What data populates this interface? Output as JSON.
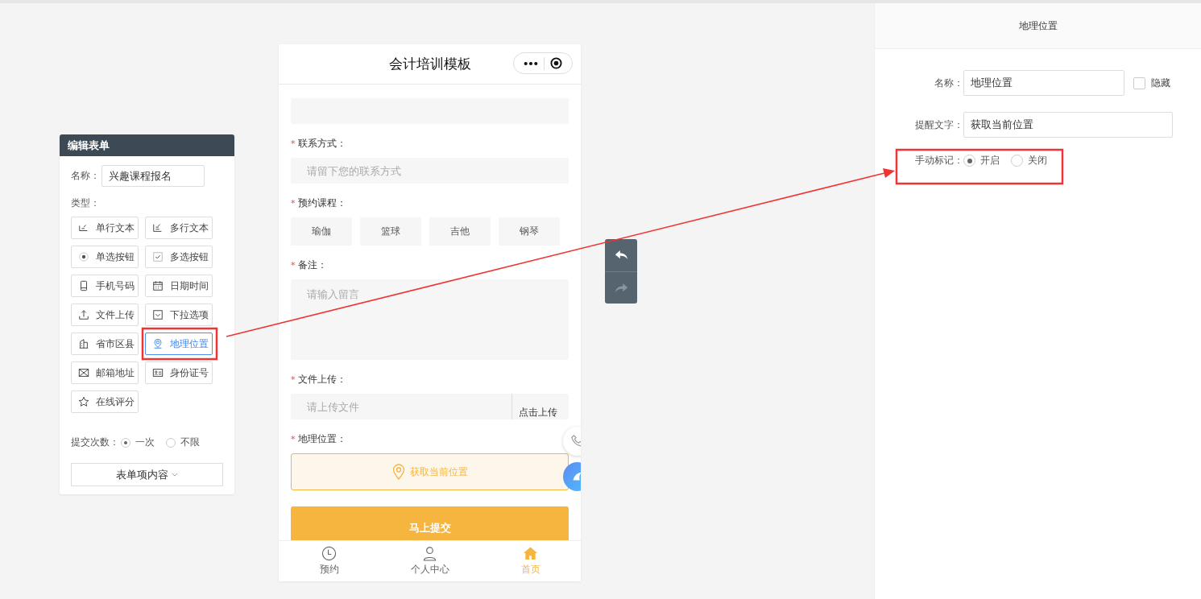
{
  "editor": {
    "title": "编辑表单",
    "name_label": "名称：",
    "name_value": "兴趣课程报名",
    "type_label": "类型：",
    "types": [
      {
        "label": "单行文本",
        "selected": false
      },
      {
        "label": "多行文本",
        "selected": false
      },
      {
        "label": "单选按钮",
        "selected": false
      },
      {
        "label": "多选按钮",
        "selected": false
      },
      {
        "label": "手机号码",
        "selected": false
      },
      {
        "label": "日期时间",
        "selected": false
      },
      {
        "label": "文件上传",
        "selected": false
      },
      {
        "label": "下拉选项",
        "selected": false
      },
      {
        "label": "省市区县",
        "selected": false
      },
      {
        "label": "地理位置",
        "selected": true
      },
      {
        "label": "邮箱地址",
        "selected": false
      },
      {
        "label": "身份证号",
        "selected": false
      },
      {
        "label": "在线评分",
        "selected": false
      }
    ],
    "submit_label": "提交次数：",
    "submit_options": [
      {
        "label": "一次",
        "selected": true
      },
      {
        "label": "不限",
        "selected": false
      }
    ],
    "content_button": "表单项内容"
  },
  "phone": {
    "title": "会计培训模板",
    "fields": [
      {
        "kind": "blank"
      },
      {
        "kind": "input",
        "mark": "*",
        "label": "联系方式：",
        "placeholder": "请留下您的联系方式"
      },
      {
        "kind": "choices",
        "mark": "*",
        "label": "预约课程：",
        "options": [
          "瑜伽",
          "篮球",
          "吉他",
          "钢琴"
        ]
      },
      {
        "kind": "textarea",
        "mark": "*",
        "label": "备注：",
        "placeholder": "请输入留言"
      },
      {
        "kind": "upload",
        "mark": "*",
        "label": "文件上传：",
        "placeholder": "请上传文件",
        "button": "点击上传"
      },
      {
        "kind": "location",
        "mark": "*",
        "label": "地理位置：",
        "button": "获取当前位置"
      }
    ],
    "submit": "马上提交",
    "tabs": [
      {
        "label": "预约",
        "selected": false
      },
      {
        "label": "个人中心",
        "selected": false
      },
      {
        "label": "首页",
        "selected": true
      }
    ]
  },
  "history": {
    "undo": {
      "disabled": false
    },
    "redo": {
      "disabled": true
    }
  },
  "settings": {
    "title": "地理位置",
    "name": {
      "label": "名称：",
      "value": "地理位置"
    },
    "hide": {
      "label": "隐藏",
      "checked": false
    },
    "hint": {
      "label": "提醒文字：",
      "value": "获取当前位置"
    },
    "manual_label": "手动标记：",
    "manual_options": [
      {
        "label": "开启",
        "selected": true
      },
      {
        "label": "关闭",
        "selected": false
      }
    ]
  }
}
